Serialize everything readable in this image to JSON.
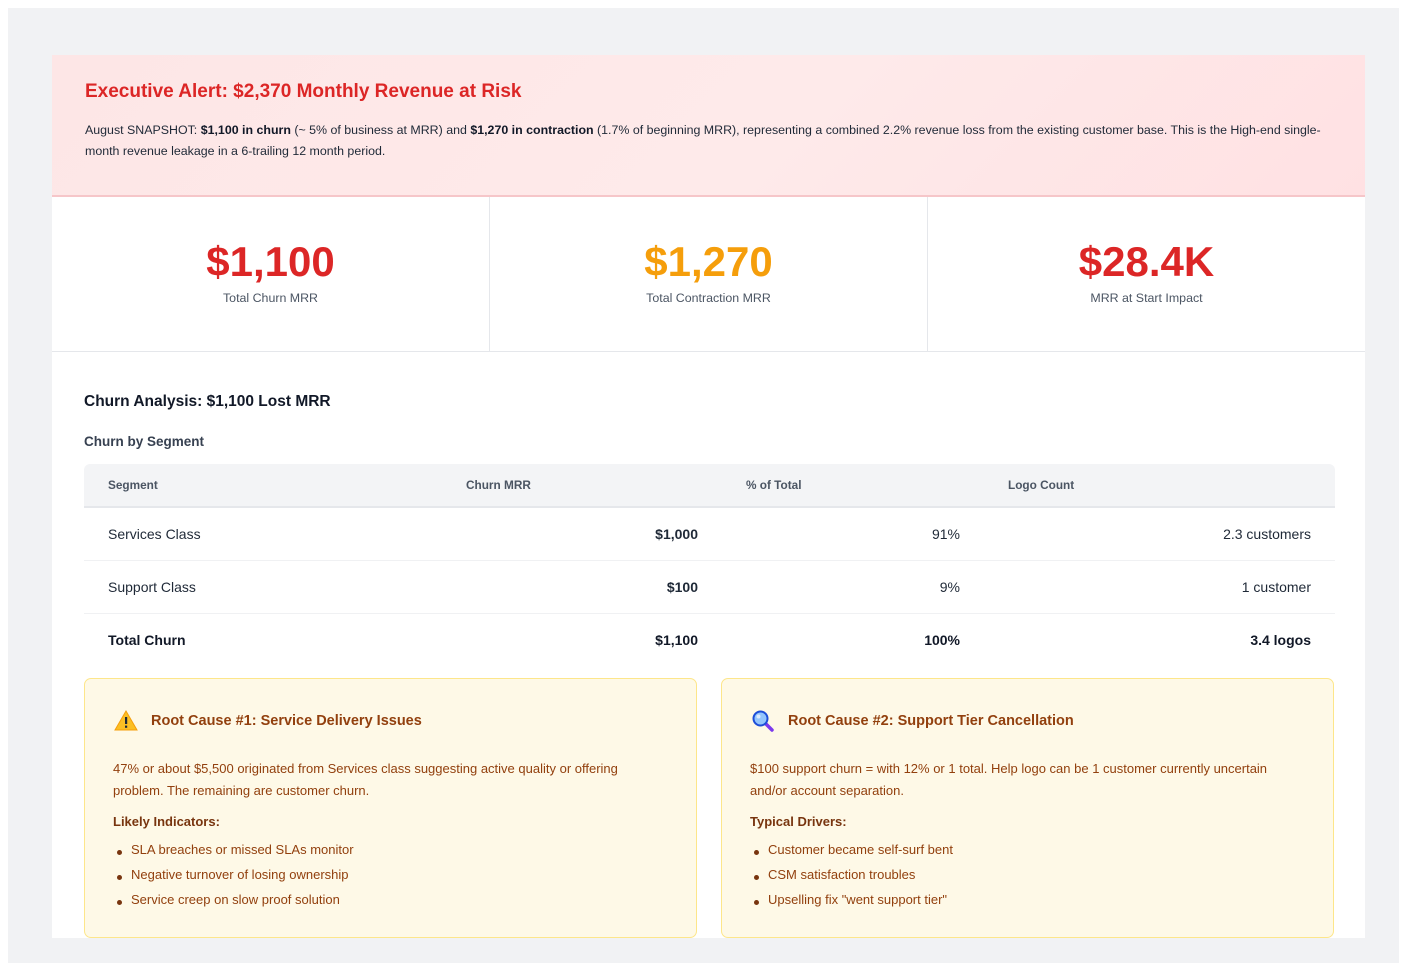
{
  "alert": {
    "title": "Executive Alert: $2,370 Monthly Revenue at Risk",
    "prefix": "August SNAPSHOT: ",
    "churn_bold": "$1,100 in churn",
    "churn_note": " (~ 5% of business at MRR) and ",
    "contraction_bold": "$1,270 in contraction",
    "rest": " (1.7% of beginning MRR), representing a combined 2.2% revenue loss from the existing customer base. This is the High-end single-month revenue leakage in a 6-trailing 12 month period."
  },
  "stats": [
    {
      "value": "$1,100",
      "label": "Total Churn MRR",
      "color": "#dc2626"
    },
    {
      "value": "$1,270",
      "label": "Total Contraction MRR",
      "color": "#f59e0b"
    },
    {
      "value": "$28.4K",
      "label": "MRR at Start Impact",
      "color": "#dc2626"
    }
  ],
  "analysis": {
    "title": "Churn Analysis: $1,100 Lost MRR",
    "subtitle": "Churn by Segment",
    "columns": [
      "Segment",
      "Churn MRR",
      "% of Total",
      "Logo Count"
    ],
    "rows": [
      {
        "segment": "Services Class",
        "mrr": "$1,000",
        "pct": "91%",
        "logos": "2.3 customers"
      },
      {
        "segment": "Support Class",
        "mrr": "$100",
        "pct": "9%",
        "logos": "1 customer"
      },
      {
        "segment": "Total Churn",
        "mrr": "$1,100",
        "pct": "100%",
        "logos": "3.4 logos"
      }
    ]
  },
  "causes": [
    {
      "icon": "warning-icon",
      "title": "Root Cause #1: Service Delivery Issues",
      "text": "47% or about $5,500 originated from Services class suggesting active quality or offering problem. The remaining are customer churn.",
      "sub": "Likely Indicators:",
      "items": [
        "SLA breaches or missed SLAs monitor",
        "Negative turnover of losing ownership",
        "Service creep on slow proof solution"
      ]
    },
    {
      "icon": "magnifier-icon",
      "title": "Root Cause #2: Support Tier Cancellation",
      "text": "$100 support churn = with 12% or 1 total. Help logo can be 1 customer currently uncertain and/or account separation.",
      "sub": "Typical Drivers:",
      "items": [
        "Customer became self-surf bent",
        "CSM satisfaction troubles",
        "Upselling fix \"went support tier\""
      ]
    }
  ]
}
